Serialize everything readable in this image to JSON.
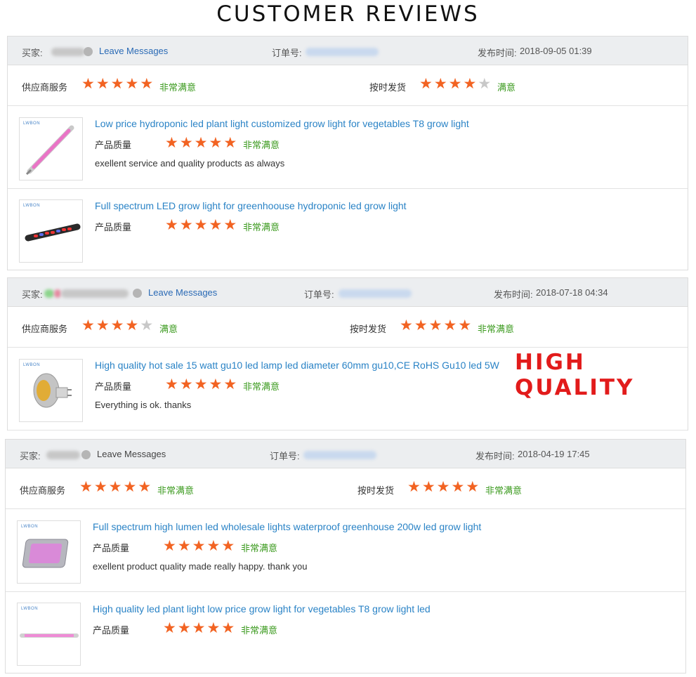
{
  "page_title": "CUSTOMER REVIEWS",
  "overlay_text": "HIGH QUALITY",
  "colors": {
    "star": "#f26322",
    "star_off": "#c8c8c8",
    "green": "#3b9a1e",
    "link": "#2a83c6",
    "overlay": "#e21b1b"
  },
  "labels": {
    "buyer": "买家:",
    "leave_messages": "Leave Messages",
    "order_no": "订单号:",
    "published": "发布时间:",
    "supplier_service": "供应商服务",
    "on_time_shipping": "按时发货",
    "product_quality": "产品质量"
  },
  "reviews": [
    {
      "date": "2018-09-05 01:39",
      "supplier_rating": 5,
      "supplier_text": "非常满意",
      "shipping_rating": 4,
      "shipping_text": "满意",
      "products": [
        {
          "title": "Low price hydroponic led plant light customized grow light for vegetables T8 grow light",
          "rating": 5,
          "rating_text": "非常满意",
          "comment": "exellent service and quality products as always"
        },
        {
          "title": "Full spectrum LED grow light for greenhoouse hydroponic led grow light",
          "rating": 5,
          "rating_text": "非常满意",
          "comment": ""
        }
      ]
    },
    {
      "date": "2018-07-18 04:34",
      "supplier_rating": 4,
      "supplier_text": "满意",
      "shipping_rating": 5,
      "shipping_text": "非常满意",
      "products": [
        {
          "title": "High quality hot sale 15 watt gu10 led lamp led diameter 60mm gu10,CE RoHS Gu10 led 5W",
          "rating": 5,
          "rating_text": "非常满意",
          "comment": "Everything is ok. thanks"
        }
      ]
    },
    {
      "date": "2018-04-19 17:45",
      "supplier_rating": 5,
      "supplier_text": "非常满意",
      "shipping_rating": 5,
      "shipping_text": "非常满意",
      "products": [
        {
          "title": "Full spectrum high lumen led wholesale lights waterproof greenhouse 200w led grow light",
          "rating": 5,
          "rating_text": "非常满意",
          "comment": "exellent product quality made really happy. thank you"
        },
        {
          "title": "High quality led plant light low price grow light for vegetables T8 grow light led",
          "rating": 5,
          "rating_text": "非常满意",
          "comment": ""
        }
      ]
    }
  ]
}
